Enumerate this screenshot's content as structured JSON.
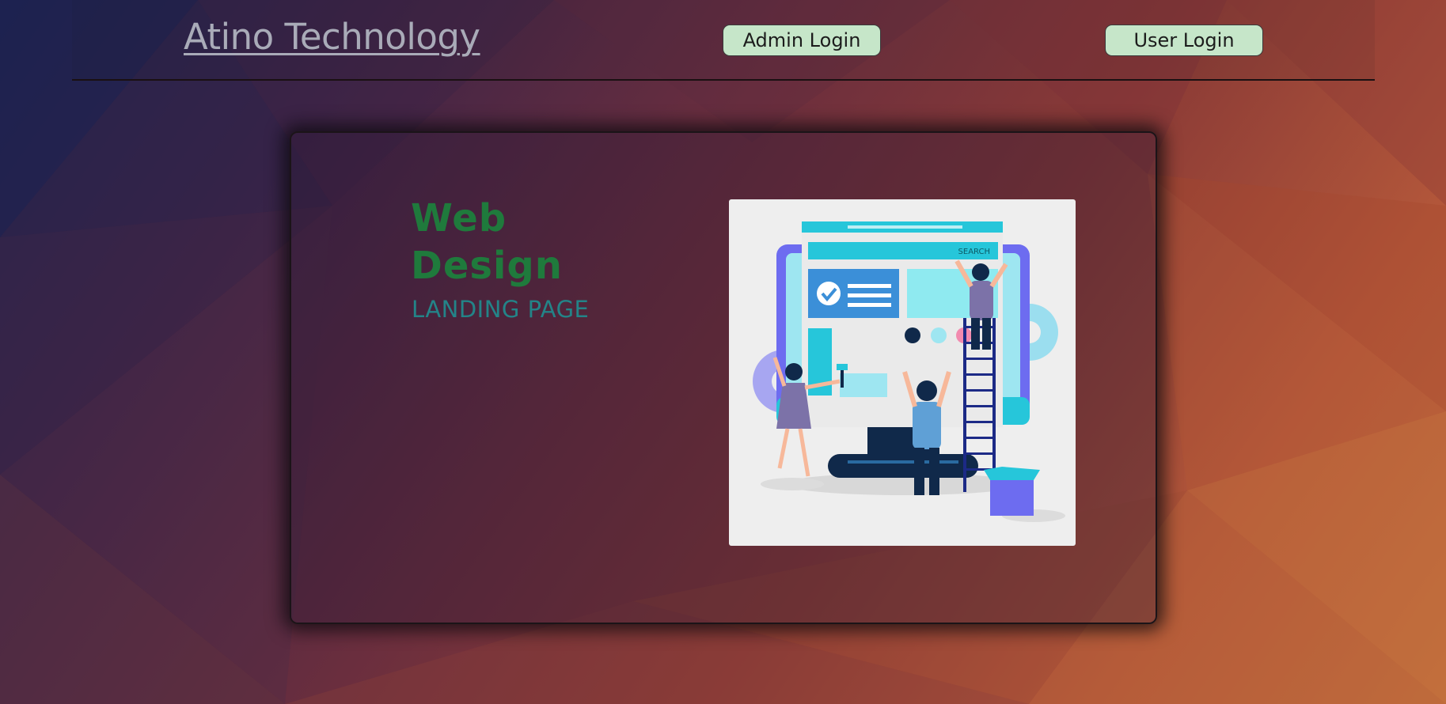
{
  "header": {
    "brand": "Atino Technology",
    "admin_login_label": "Admin Login",
    "user_login_label": "User Login"
  },
  "hero": {
    "title_line1": "Web",
    "title_line2": "Design",
    "subtitle": "LANDING PAGE",
    "illustration": {
      "icon": "web-design-team-illustration",
      "search_label": "SEARCH"
    }
  },
  "colors": {
    "button_bg": "#c6e6c9",
    "title": "#1f7a3c",
    "subtitle": "#238488",
    "brand": "#a9abb8"
  }
}
